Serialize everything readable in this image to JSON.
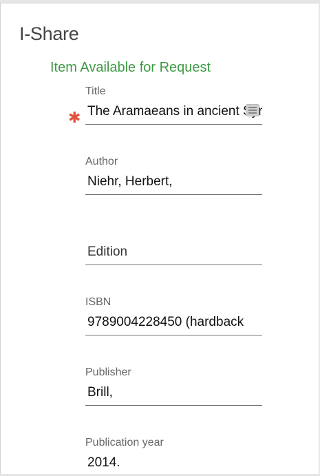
{
  "header": {
    "title": "I-Share",
    "availability": "Item Available for Request"
  },
  "fields": {
    "title": {
      "label": "Title",
      "value": "The Aramaeans in ancient Syria",
      "required": true
    },
    "author": {
      "label": "Author",
      "value": "Niehr, Herbert,"
    },
    "edition": {
      "label": "",
      "placeholder": "Edition"
    },
    "isbn": {
      "label": "ISBN",
      "value": "9789004228450 (hardback"
    },
    "publisher": {
      "label": "Publisher",
      "value": "Brill,"
    },
    "publication_year": {
      "label": "Publication year",
      "value": "2014."
    }
  },
  "colors": {
    "accent": "#3f9a46",
    "required": "#e2543f",
    "label": "#666666"
  },
  "icons": {
    "title_field_icon": "text-expand-icon",
    "required_icon": "asterisk-icon"
  }
}
